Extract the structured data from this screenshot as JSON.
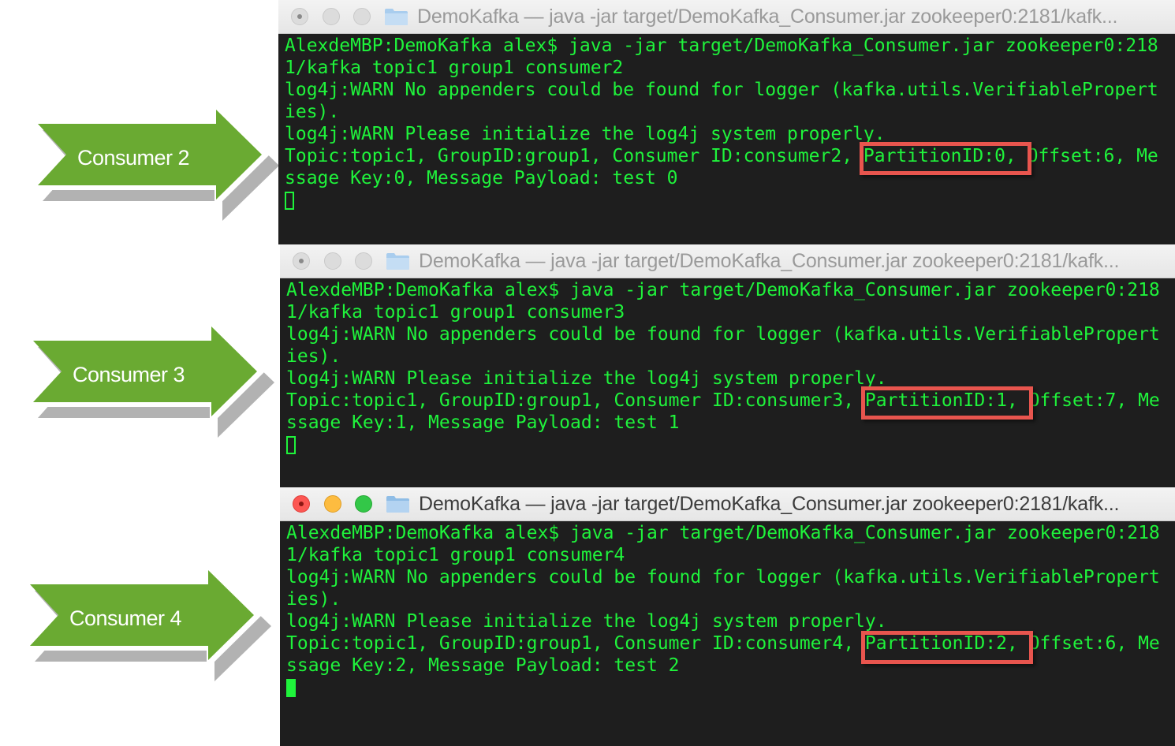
{
  "arrows": [
    {
      "label": "Consumer 2"
    },
    {
      "label": "Consumer 3"
    },
    {
      "label": "Consumer 4"
    }
  ],
  "colors": {
    "arrow_green": "#6aaa32",
    "terminal_text": "#1ff33b",
    "terminal_bg": "#1e1e1e",
    "highlight_box": "#e8554e"
  },
  "terminals": [
    {
      "title": "DemoKafka — java -jar target/DemoKafka_Consumer.jar zookeeper0:2181/kafk...",
      "active": false,
      "lines": [
        "AlexdeMBP:DemoKafka alex$ java -jar target/DemoKafka_Consumer.jar zookeeper0:218",
        "1/kafka topic1 group1 consumer2",
        "log4j:WARN No appenders could be found for logger (kafka.utils.VerifiablePropert",
        "ies).",
        "log4j:WARN Please initialize the log4j system properly.",
        "Topic:topic1, GroupID:group1, Consumer ID:consumer2, PartitionID:0, Offset:6, Me",
        "ssage Key:0, Message Payload: test 0"
      ],
      "highlighted": "PartitionID:0,"
    },
    {
      "title": "DemoKafka — java -jar target/DemoKafka_Consumer.jar zookeeper0:2181/kafk...",
      "active": false,
      "lines": [
        "AlexdeMBP:DemoKafka alex$ java -jar target/DemoKafka_Consumer.jar zookeeper0:218",
        "1/kafka topic1 group1 consumer3",
        "log4j:WARN No appenders could be found for logger (kafka.utils.VerifiablePropert",
        "ies).",
        "log4j:WARN Please initialize the log4j system properly.",
        "Topic:topic1, GroupID:group1, Consumer ID:consumer3, PartitionID:1, Offset:7, Me",
        "ssage Key:1, Message Payload: test 1"
      ],
      "highlighted": "PartitionID:1,"
    },
    {
      "title": "DemoKafka — java -jar target/DemoKafka_Consumer.jar zookeeper0:2181/kafk...",
      "active": true,
      "lines": [
        "AlexdeMBP:DemoKafka alex$ java -jar target/DemoKafka_Consumer.jar zookeeper0:218",
        "1/kafka topic1 group1 consumer4",
        "log4j:WARN No appenders could be found for logger (kafka.utils.VerifiablePropert",
        "ies).",
        "log4j:WARN Please initialize the log4j system properly.",
        "Topic:topic1, GroupID:group1, Consumer ID:consumer4, PartitionID:2, Offset:6, Me",
        "ssage Key:2, Message Payload: test 2"
      ],
      "highlighted": "PartitionID:2,"
    }
  ]
}
